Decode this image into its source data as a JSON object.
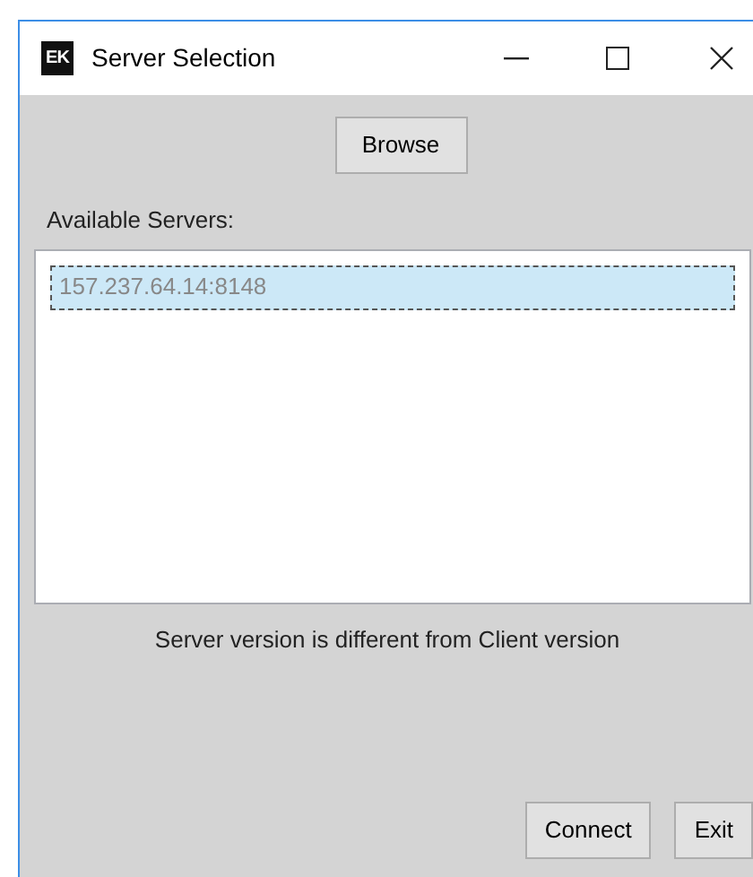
{
  "window": {
    "icon_text": "EK",
    "title": "Server Selection"
  },
  "browse_button": "Browse",
  "servers_label": "Available Servers:",
  "servers": [
    {
      "address": "157.237.64.14:8148",
      "selected": true
    }
  ],
  "message": "Server version is different from Client version",
  "buttons": [
    "Connect",
    "Exit"
  ]
}
